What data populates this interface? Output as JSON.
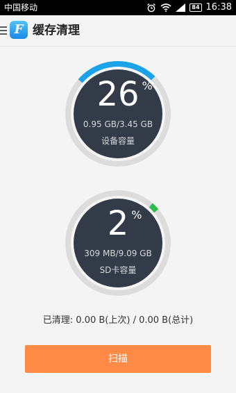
{
  "status_bar": {
    "carrier": "中国移动",
    "battery": "84",
    "time": "16:38"
  },
  "header": {
    "logo_letter": "F",
    "title": "缓存清理"
  },
  "device_storage": {
    "percent": "26",
    "percent_sign": "%",
    "usage": "0.95 GB/3.45 GB",
    "label": "设备容量",
    "fill_fraction": 0.26,
    "arc_color": "#1aa3e8"
  },
  "sd_storage": {
    "percent": "2",
    "percent_sign": "%",
    "usage": "309 MB/9.09 GB",
    "label": "SD卡容量",
    "fill_fraction": 0.02,
    "arc_color": "#2dbb4e"
  },
  "cleaned": {
    "text": "已清理: 0.00 B(上次) / 0.00 B(总计)"
  },
  "scan_button": {
    "label": "扫描"
  },
  "colors": {
    "accent": "#ff8a45",
    "gauge_face": "#333b48",
    "gauge_track": "#dcdcdc"
  }
}
